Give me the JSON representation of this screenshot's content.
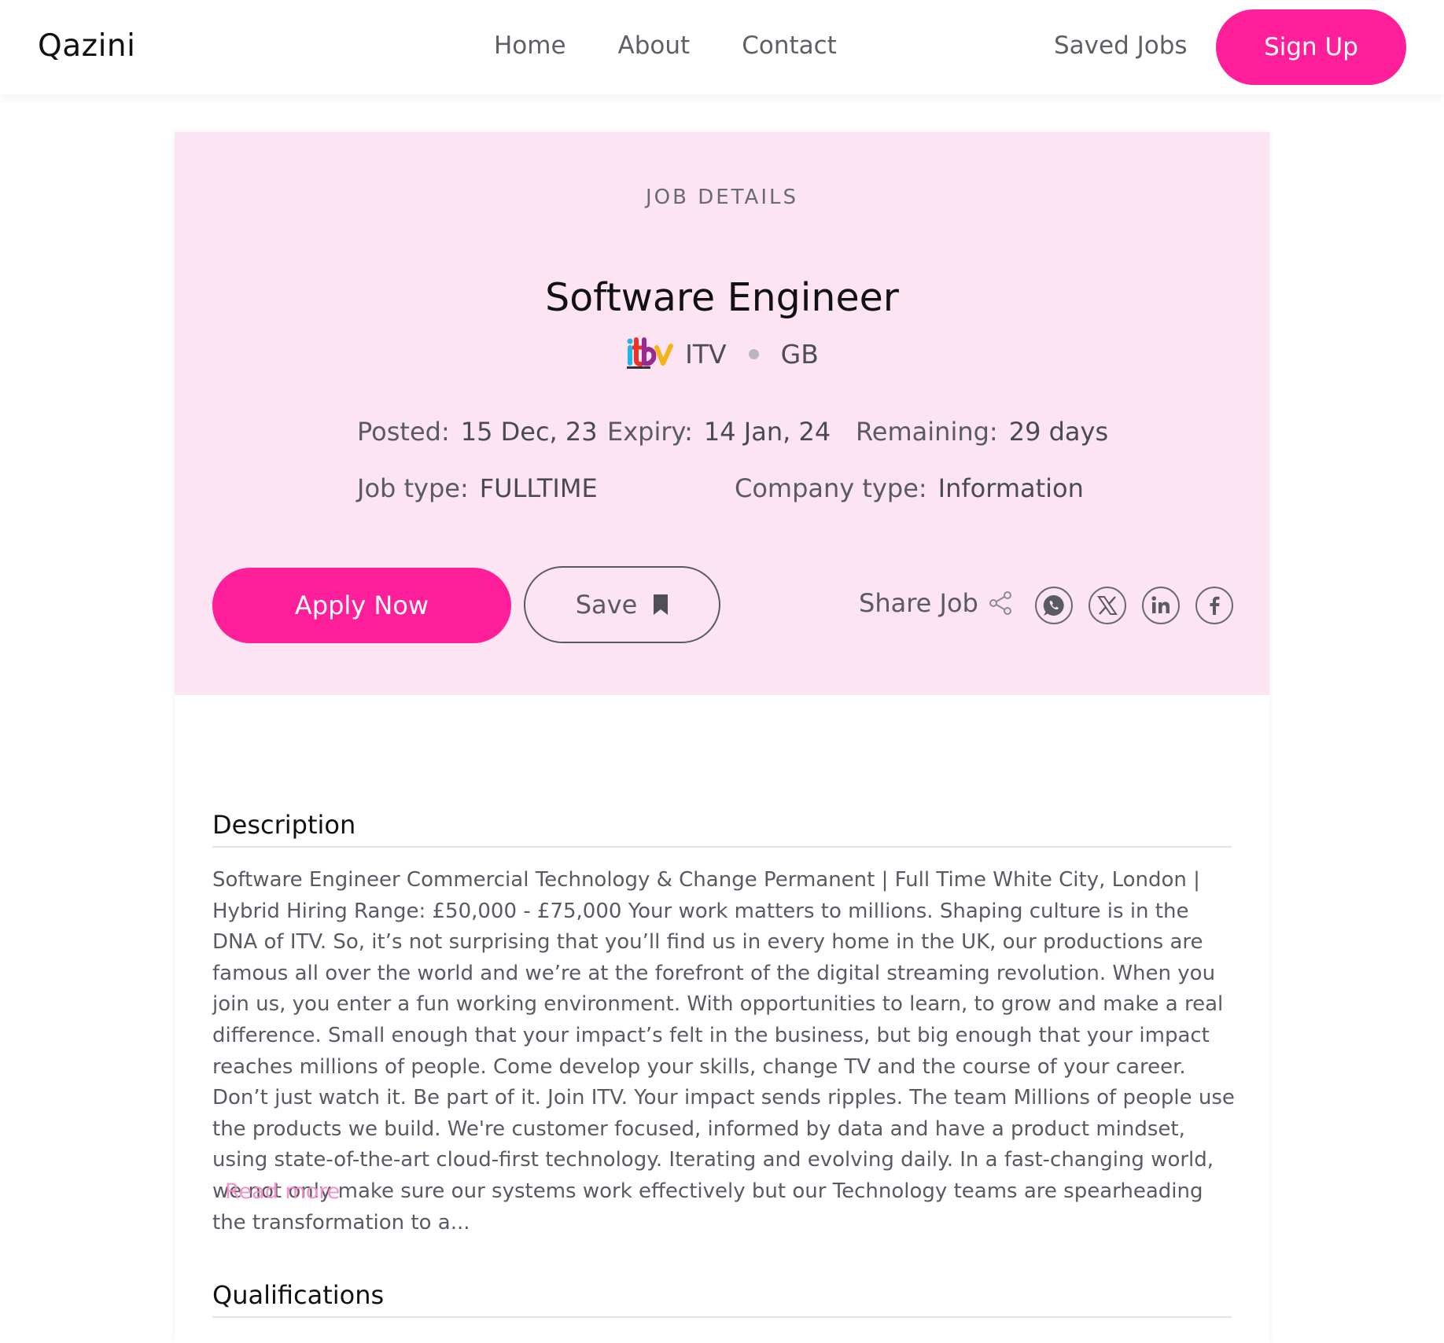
{
  "header": {
    "brand": "Qazini",
    "nav": [
      "Home",
      "About",
      "Contact"
    ],
    "saved_jobs": "Saved Jobs",
    "sign_up": "Sign Up"
  },
  "job": {
    "eyebrow": "JOB DETAILS",
    "title": "Software Engineer",
    "company": "ITV",
    "country": "GB",
    "posted_label": "Posted:",
    "posted": "15 Dec, 23",
    "expiry_label": "Expiry:",
    "expiry": "14 Jan, 24",
    "remaining_label": "Remaining:",
    "remaining": "29 days",
    "job_type_label": "Job type:",
    "job_type": "FULLTIME",
    "company_type_label": "Company type:",
    "company_type": "Information"
  },
  "actions": {
    "apply": "Apply Now",
    "save": "Save",
    "share": "Share Job",
    "social_icons": [
      "whatsapp-icon",
      "x-icon",
      "linkedin-icon",
      "facebook-icon"
    ]
  },
  "sections": {
    "description_title": "Description",
    "description": "Software Engineer Commercial Technology & Change Permanent | Full Time White City, London | Hybrid Hiring Range: £50,000 - £75,000 Your work matters to millions. Shaping culture is in the DNA of ITV. So, it’s not surprising that you’ll find us in every home in the UK, our productions are famous all over the world and we’re at the forefront of the digital streaming revolution. When you join us, you enter a fun working environment. With opportunities to learn, to grow and make a real difference. Small enough that your impact’s felt in the business, but big enough that your impact reaches millions of people. Come develop your skills, change TV and the course of your career. Don’t just watch it. Be part of it. Join ITV. Your impact sends ripples. The team Millions of people use the products we build. We're customer focused, informed by data and have a product mindset, using state-of-the-art cloud-first technology. Iterating and evolving daily. In a fast-changing world, we not only make sure our systems work effectively but our Technology teams are spearheading the transformation to a...",
    "read_more": "Read more",
    "qualifications_title": "Qualifications"
  },
  "colors": {
    "accent": "#ff1f9a",
    "hero_bg": "#fde4f2",
    "read_more": "#f592c9"
  }
}
